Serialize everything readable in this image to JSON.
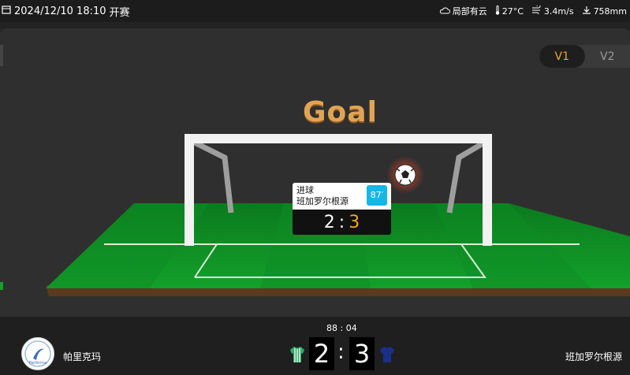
{
  "header": {
    "datetime": "2024/12/10 18:10",
    "status": "开赛",
    "weather": "局部有云",
    "temperature": "27°C",
    "wind": "3.4m/s",
    "pressure": "758mm"
  },
  "toggle": {
    "v1": "V1",
    "v2": "V2",
    "active": "V1"
  },
  "stage": {
    "event_title": "Goal"
  },
  "event_card": {
    "type": "进球",
    "team": "班加罗尔根源",
    "minute": "87′",
    "home_score": "2",
    "away_score": "3"
  },
  "match": {
    "clock": "88 : 04",
    "home_team": "帕里克玛",
    "away_team": "班加罗尔根源",
    "home_score": "2",
    "away_score": "3",
    "separator": ":"
  },
  "colors": {
    "accent": "#f0a624",
    "minute_badge": "#16b6e8",
    "home_kit": "#1f8f5a",
    "away_kit": "#1b2f8a"
  },
  "icons": {
    "weather": "cloud-icon",
    "temperature": "thermometer-icon",
    "wind": "wind-icon",
    "pressure": "pressure-icon"
  }
}
